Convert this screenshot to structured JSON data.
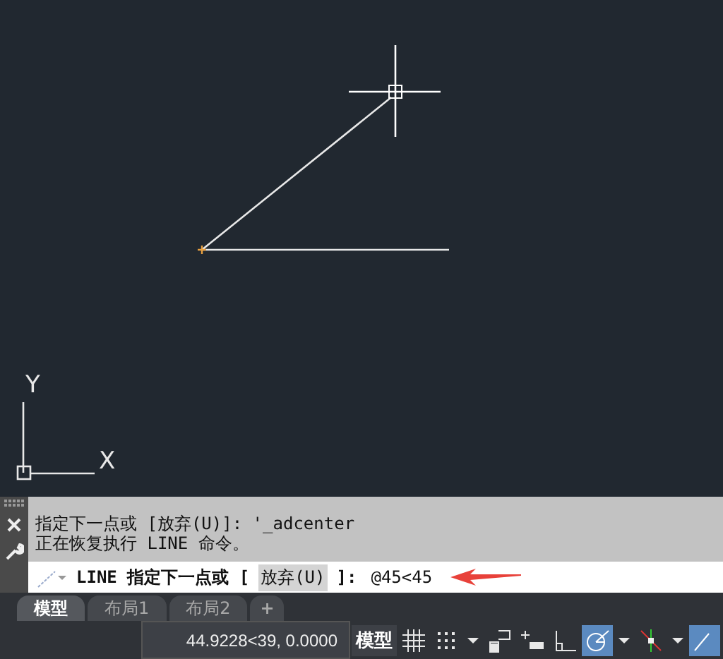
{
  "canvas": {
    "ucs": {
      "x_label": "X",
      "y_label": "Y"
    }
  },
  "command_history": [
    "指定下一点或 [放弃(U)]: '_adcenter",
    "正在恢复执行 LINE 命令。"
  ],
  "command_line": {
    "prompt": "LINE 指定下一点或 [",
    "option": "放弃(U)",
    "suffix": "]:",
    "value": "@45<45"
  },
  "layout_tabs": [
    {
      "label": "模型",
      "selected": true
    },
    {
      "label": "布局1",
      "selected": false
    },
    {
      "label": "布局2",
      "selected": false
    }
  ],
  "add_tab": "+",
  "status_bar": {
    "coordinates": "44.9228<39, 0.0000",
    "space": "模型",
    "tools": [
      {
        "kind": "grid",
        "active": false
      },
      {
        "kind": "snap",
        "active": false
      },
      {
        "kind": "caret",
        "active": false
      },
      {
        "kind": "infer",
        "active": false
      },
      {
        "kind": "dyn",
        "active": false
      },
      {
        "kind": "ortho",
        "active": false
      },
      {
        "kind": "polar",
        "active": true
      },
      {
        "kind": "caret",
        "active": false
      },
      {
        "kind": "osnap",
        "active": false
      },
      {
        "kind": "caret",
        "active": false
      },
      {
        "kind": "partial",
        "active": true
      }
    ]
  }
}
